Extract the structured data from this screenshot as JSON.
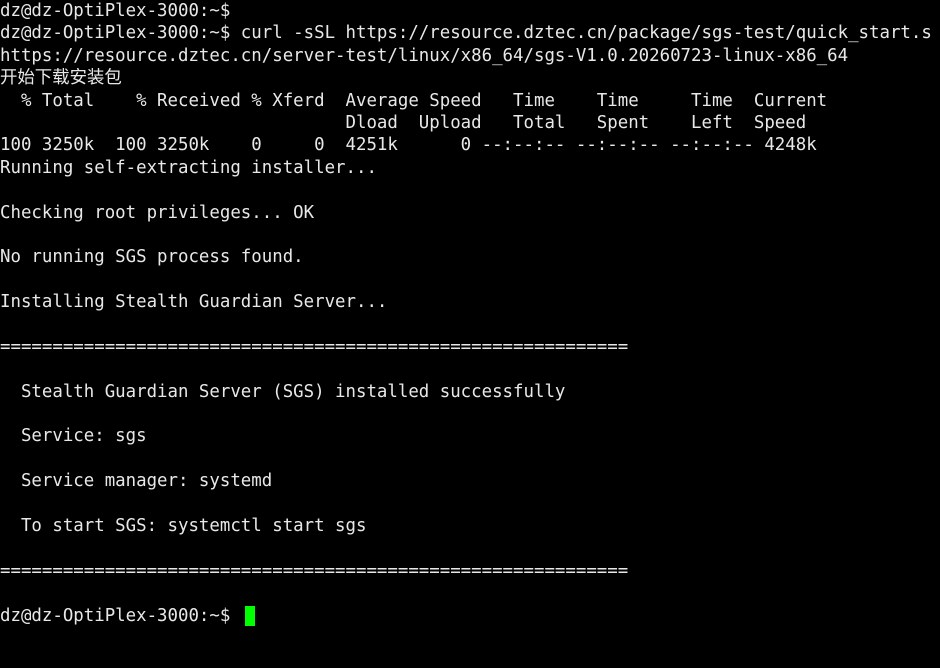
{
  "terminal": {
    "foreground": "#e8e8e8",
    "background": "#000000",
    "cursor_color": "#00ff00",
    "lines": [
      "dz@dz-OptiPlex-3000:~$",
      "dz@dz-OptiPlex-3000:~$ curl -sSL https://resource.dztec.cn/package/sgs-test/quick_start.s",
      "https://resource.dztec.cn/server-test/linux/x86_64/sgs-V1.0.20260723-linux-x86_64",
      "开始下载安装包",
      "  % Total    % Received % Xferd  Average Speed   Time    Time     Time  Current",
      "                                 Dload  Upload   Total   Spent    Left  Speed",
      "100 3250k  100 3250k    0     0  4251k      0 --:--:-- --:--:-- --:--:-- 4248k",
      "Running self-extracting installer...",
      "",
      "Checking root privileges... OK",
      "",
      "No running SGS process found.",
      "",
      "Installing Stealth Guardian Server...",
      "",
      "============================================================",
      "",
      "  Stealth Guardian Server (SGS) installed successfully",
      "",
      "  Service: sgs",
      "",
      "  Service manager: systemd",
      "",
      "  To start SGS: systemctl start sgs",
      "",
      "============================================================",
      ""
    ],
    "prompt": "dz@dz-OptiPlex-3000:~$ "
  }
}
